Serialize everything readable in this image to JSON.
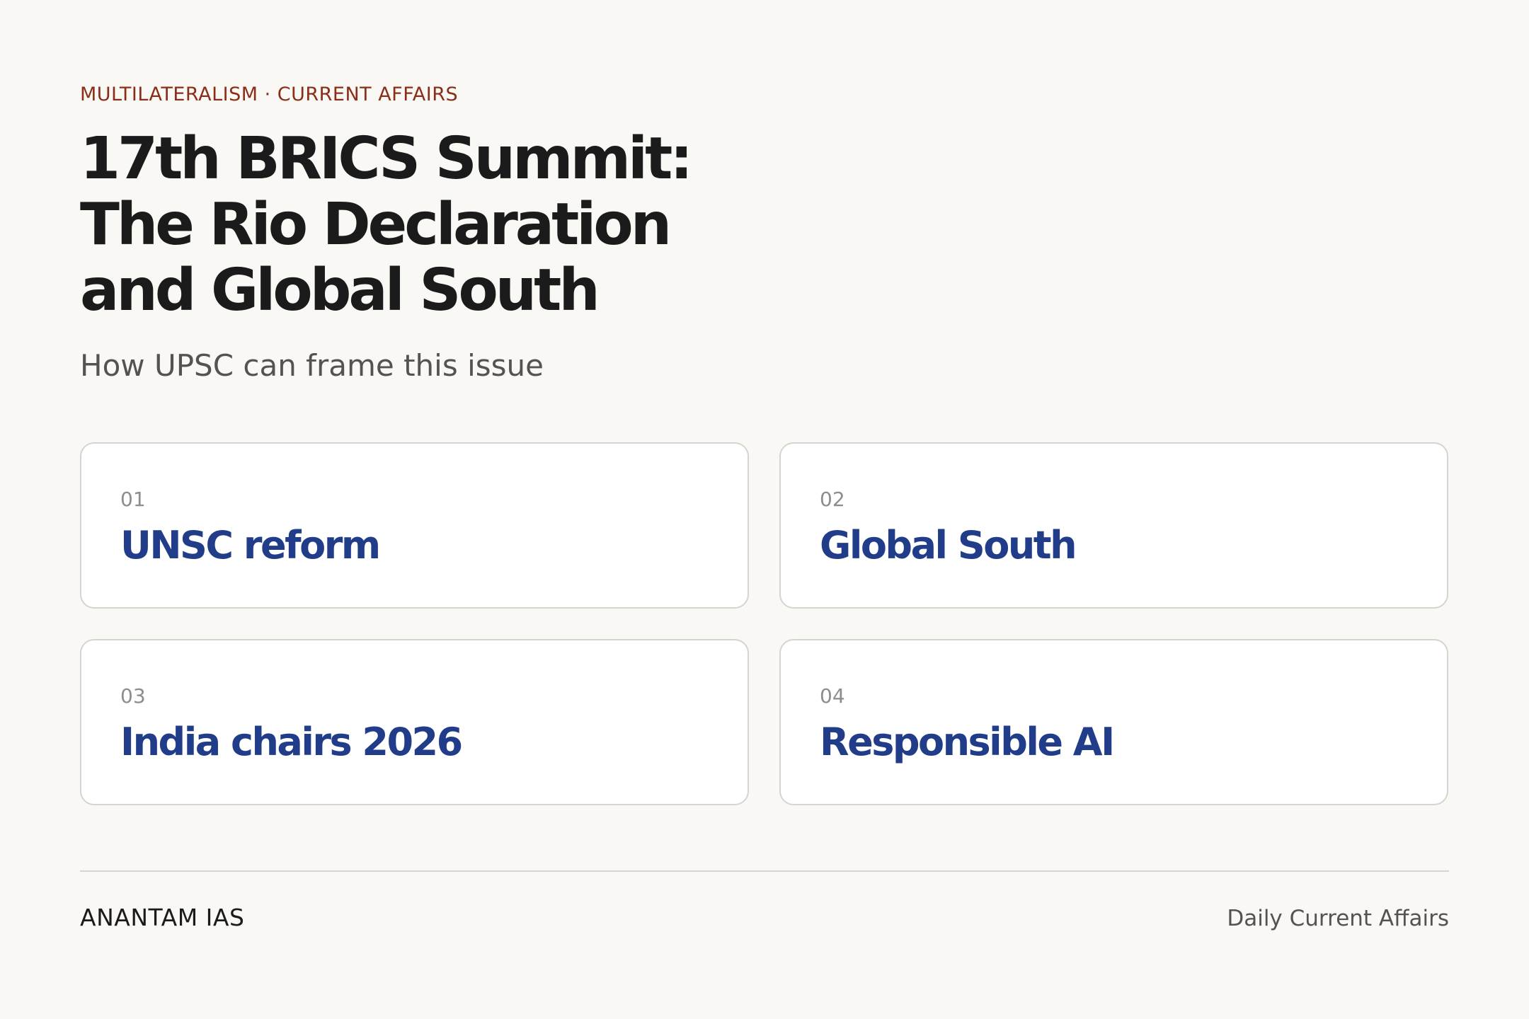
{
  "header": {
    "kicker": "MULTILATERALISM · CURRENT AFFAIRS",
    "title_lines": [
      "17th BRICS Summit:",
      "The Rio Declaration",
      "and Global South"
    ],
    "subtitle": "How UPSC can frame this issue"
  },
  "cards": [
    {
      "number": "01",
      "label": "UNSC reform"
    },
    {
      "number": "02",
      "label": "Global South"
    },
    {
      "number": "03",
      "label": "India chairs 2026"
    },
    {
      "number": "04",
      "label": "Responsible AI"
    }
  ],
  "footer": {
    "brand": "ANANTAM IAS",
    "tagline": "Daily Current Affairs"
  },
  "colors": {
    "background": "#f9f8f4",
    "kicker": "#8a2e17",
    "card_label": "#213d8a",
    "title": "#1b1b1b"
  }
}
